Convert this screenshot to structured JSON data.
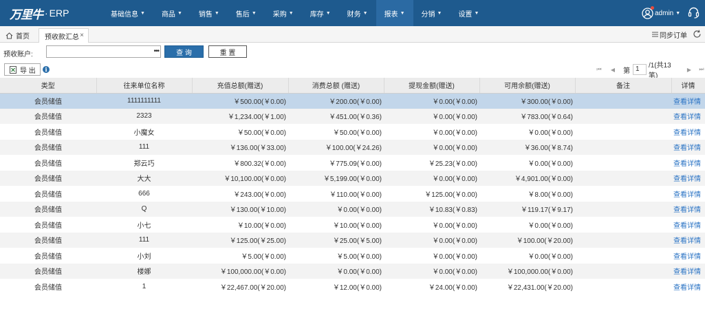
{
  "app": {
    "brand": "万里牛",
    "dot": "·",
    "product": "ERP"
  },
  "nav": [
    {
      "label": "基础信息",
      "active": false
    },
    {
      "label": "商品",
      "active": false
    },
    {
      "label": "销售",
      "active": false
    },
    {
      "label": "售后",
      "active": false
    },
    {
      "label": "采购",
      "active": false
    },
    {
      "label": "库存",
      "active": false
    },
    {
      "label": "财务",
      "active": false
    },
    {
      "label": "报表",
      "active": true
    },
    {
      "label": "分销",
      "active": false
    },
    {
      "label": "设置",
      "active": false
    }
  ],
  "user": {
    "name": "admin",
    "icon": "user-circle-icon",
    "notify_color": "#e94b3c"
  },
  "tabs": {
    "home": "首页",
    "current": "预收款汇总",
    "close": "×"
  },
  "sync_label": "同步订单",
  "query": {
    "account_label": "预收账户:",
    "account_value": "",
    "more": "•••",
    "search_label": "查 询",
    "reset_label": "重 置"
  },
  "toolbar": {
    "export_label": "导 出",
    "info_glyph": "i"
  },
  "pager": {
    "page_prefix": "第",
    "page_value": "1",
    "page_suffix": "/1(共13笔)"
  },
  "table": {
    "headers": [
      "类型",
      "往来单位名称",
      "充值总额(赠送)",
      "消费总额 (赠送)",
      "提现金额(赠送)",
      "可用余额(赠送)",
      "备注",
      "详情"
    ],
    "rows": [
      [
        "会员储值",
        "1111111111",
        "￥500.00(￥0.00)",
        "￥200.00(￥0.00)",
        "￥0.00(￥0.00)",
        "￥300.00(￥0.00)",
        "",
        "查看详情"
      ],
      [
        "会员储值",
        "2323",
        "￥1,234.00(￥1.00)",
        "￥451.00(￥0.36)",
        "￥0.00(￥0.00)",
        "￥783.00(￥0.64)",
        "",
        "查看详情"
      ],
      [
        "会员储值",
        "小魔女",
        "￥50.00(￥0.00)",
        "￥50.00(￥0.00)",
        "￥0.00(￥0.00)",
        "￥0.00(￥0.00)",
        "",
        "查看详情"
      ],
      [
        "会员储值",
        "111",
        "￥136.00(￥33.00)",
        "￥100.00(￥24.26)",
        "￥0.00(￥0.00)",
        "￥36.00(￥8.74)",
        "",
        "查看详情"
      ],
      [
        "会员储值",
        "郑云巧",
        "￥800.32(￥0.00)",
        "￥775.09(￥0.00)",
        "￥25.23(￥0.00)",
        "￥0.00(￥0.00)",
        "",
        "查看详情"
      ],
      [
        "会员储值",
        "大大",
        "￥10,100.00(￥0.00)",
        "￥5,199.00(￥0.00)",
        "￥0.00(￥0.00)",
        "￥4,901.00(￥0.00)",
        "",
        "查看详情"
      ],
      [
        "会员储值",
        "666",
        "￥243.00(￥0.00)",
        "￥110.00(￥0.00)",
        "￥125.00(￥0.00)",
        "￥8.00(￥0.00)",
        "",
        "查看详情"
      ],
      [
        "会员储值",
        "Q",
        "￥130.00(￥10.00)",
        "￥0.00(￥0.00)",
        "￥10.83(￥0.83)",
        "￥119.17(￥9.17)",
        "",
        "查看详情"
      ],
      [
        "会员储值",
        "小七",
        "￥10.00(￥0.00)",
        "￥10.00(￥0.00)",
        "￥0.00(￥0.00)",
        "￥0.00(￥0.00)",
        "",
        "查看详情"
      ],
      [
        "会员储值",
        "111",
        "￥125.00(￥25.00)",
        "￥25.00(￥5.00)",
        "￥0.00(￥0.00)",
        "￥100.00(￥20.00)",
        "",
        "查看详情"
      ],
      [
        "会员储值",
        "小刘",
        "￥5.00(￥0.00)",
        "￥5.00(￥0.00)",
        "￥0.00(￥0.00)",
        "￥0.00(￥0.00)",
        "",
        "查看详情"
      ],
      [
        "会员储值",
        "楼娜",
        "￥100,000.00(￥0.00)",
        "￥0.00(￥0.00)",
        "￥0.00(￥0.00)",
        "￥100,000.00(￥0.00)",
        "",
        "查看详情"
      ],
      [
        "会员储值",
        "1",
        "￥22,467.00(￥20.00)",
        "￥12.00(￥0.00)",
        "￥24.00(￥0.00)",
        "￥22,431.00(￥20.00)",
        "",
        "查看详情"
      ]
    ],
    "selected_row": 0
  },
  "colors": {
    "nav_bg": "#1e5a8e",
    "nav_active": "#2b6aa3",
    "primary_button": "#2a6eaa",
    "link": "#2a73c4",
    "selected_row": "#c2d6ea"
  }
}
